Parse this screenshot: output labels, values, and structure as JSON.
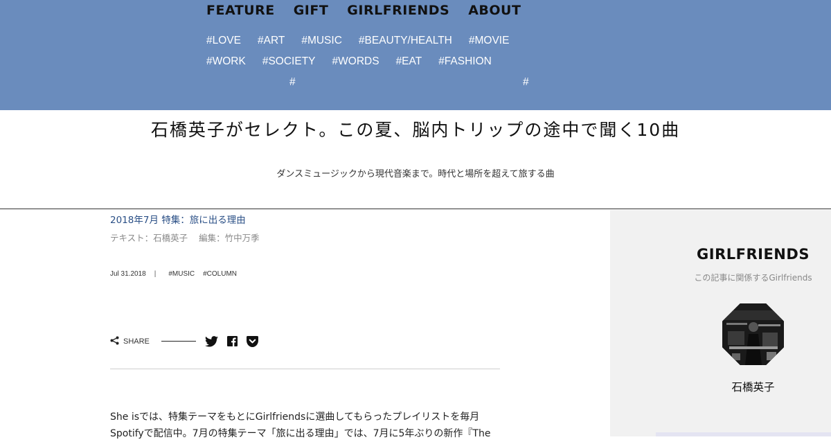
{
  "nav": {
    "items": [
      "FEATURE",
      "GIFT",
      "GIRLFRIENDS",
      "ABOUT"
    ]
  },
  "tags": {
    "row1": [
      "#LOVE",
      "#ART",
      "#MUSIC",
      "#BEAUTY/HEALTH",
      "#MOVIE"
    ],
    "row2": [
      "#WORK",
      "#SOCIETY",
      "#WORDS",
      "#EAT",
      "#FASHION"
    ],
    "row3": [
      "#",
      "#"
    ]
  },
  "article": {
    "title": "石橋英子がセレクト。この夏、脳内トリップの途中で聞く10曲",
    "subtitle": "ダンスミュージックから現代音楽まで。時代と場所を超えて旅する曲",
    "issue": "2018年7月 特集：旅に出る理由",
    "credits": {
      "text": "テキスト：石橋英子",
      "edit": "編集：竹中万季"
    },
    "date": "Jul 31.2018",
    "separator": "|",
    "tags": [
      "#MUSIC",
      "#COLUMN"
    ],
    "share_label": "SHARE",
    "social_icons": [
      "twitter-icon",
      "facebook-icon",
      "pocket-icon"
    ],
    "body": [
      "She isでは、特集テーマをもとにGirlfriendsに選曲してもらったプレイリストを毎月",
      "Spotifyで配信中。7月の特集テーマ「旅に出る理由」では、7月に5年ぶりの新作『The"
    ]
  },
  "sidebar": {
    "title": "GIRLFRIENDS",
    "subtitle": "この記事に関係するGirlfriends",
    "person": {
      "name": "石橋英子"
    }
  },
  "colors": {
    "header_bg": "#6a8cbd",
    "link_blue": "#2a4f86",
    "sidebar_bg": "#f1f1f1"
  }
}
